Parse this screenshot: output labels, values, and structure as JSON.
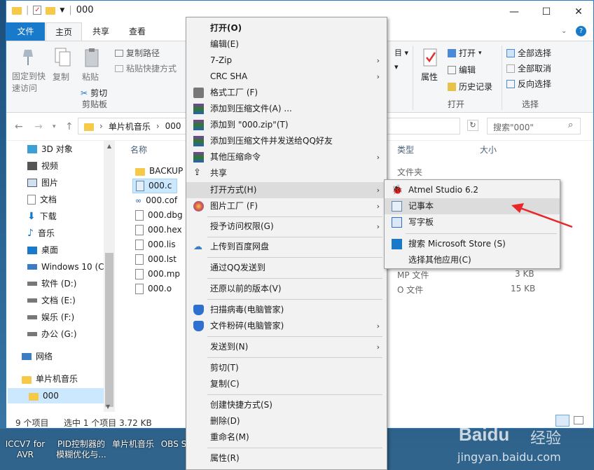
{
  "titlebar": {
    "title": "000",
    "minimize_glyph": "—",
    "maximize_glyph": "☐",
    "close_glyph": "✕",
    "help_glyph": "?"
  },
  "ribbon_tabs": [
    "文件",
    "主页",
    "共享",
    "查看"
  ],
  "ribbon": {
    "pin_label": "固定到快速访问",
    "copy_label": "复制",
    "paste_label": "粘贴",
    "copy_path": "复制路径",
    "paste_shortcut": "粘贴快捷方式",
    "cut": "剪切",
    "clipboard_group": "剪贴板",
    "properties": "属性",
    "open": "打开",
    "edit": "编辑",
    "history": "历史记录",
    "open_group": "打开",
    "select_all": "全部选择",
    "select_none": "全部取消",
    "invert": "反向选择",
    "select_group": "选择"
  },
  "address": {
    "crumbs": [
      "单片机音乐",
      "000"
    ],
    "search_placeholder": "搜索\"000\""
  },
  "nav_pane": {
    "items": [
      "3D 对象",
      "视频",
      "图片",
      "文档",
      "下载",
      "音乐",
      "桌面",
      "Windows 10 (C",
      "软件 (D:)",
      "文档 (E:)",
      "娱乐 (F:)",
      "办公 (G:)",
      "网络",
      "单片机音乐",
      "000"
    ]
  },
  "file_list": {
    "col_name": "名称",
    "col_type": "类型",
    "col_size": "大小",
    "files": [
      "BACKUP",
      "000.c",
      "000.cof",
      "000.dbg",
      "000.hex",
      "000.lis",
      "000.lst",
      "000.mp",
      "000.o"
    ],
    "type_folder": "文件夹",
    "type_mp": "MP 文件",
    "type_o": "O 文件",
    "size_mp": "3 KB",
    "size_o": "15 KB"
  },
  "status": {
    "count": "9 个项目",
    "selected": "选中 1 个项目  3.72 KB"
  },
  "context_menu": {
    "items": [
      "打开(O)",
      "编辑(E)",
      "7-Zip",
      "CRC SHA",
      "格式工厂 (F)",
      "添加到压缩文件(A) ...",
      "添加到 \"000.zip\"(T)",
      "添加到压缩文件并发送给QQ好友",
      "其他压缩命令",
      "共享",
      "打开方式(H)",
      "图片工厂 (F)",
      "授予访问权限(G)",
      "上传到百度网盘",
      "通过QQ发送到",
      "还原以前的版本(V)",
      "扫描病毒(电脑管家)",
      "文件粉碎(电脑管家)",
      "发送到(N)",
      "剪切(T)",
      "复制(C)",
      "创建快捷方式(S)",
      "删除(D)",
      "重命名(M)",
      "属性(R)"
    ]
  },
  "open_with_menu": {
    "items": [
      "Atmel Studio 6.2",
      "记事本",
      "写字板",
      "搜索 Microsoft Store (S)",
      "选择其他应用(C)"
    ]
  },
  "taskbar": {
    "items": [
      "ICCV7 for\nAVR",
      "PID控制器的\n模糊优化与...",
      "单片机音乐",
      "OBS S"
    ]
  },
  "watermark": {
    "brand": "Baidu",
    "brand_cn": "经验",
    "url": "jingyan.baidu.com"
  },
  "colors": {
    "accent": "#1979ca",
    "folder": "#f6c948",
    "selection": "#cce8ff",
    "arrow": "#e8272a"
  }
}
